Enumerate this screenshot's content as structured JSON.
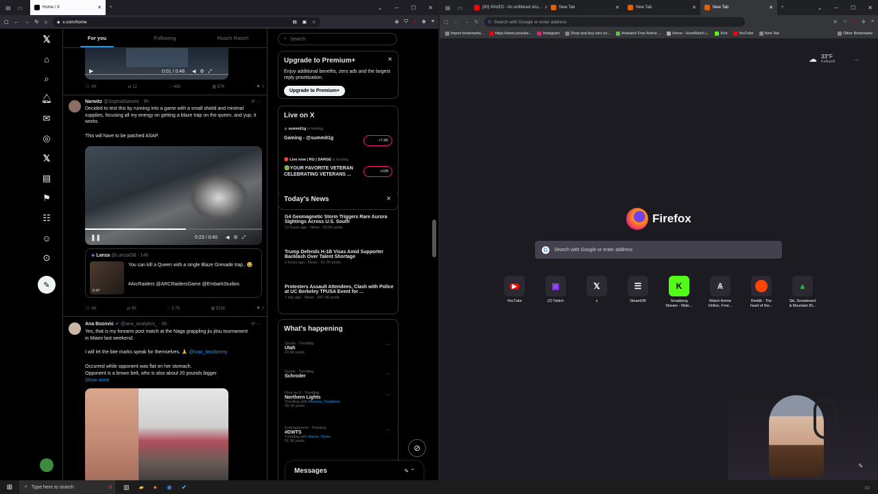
{
  "left_browser": {
    "tabs": [
      {
        "label": "Home / X",
        "active": true
      },
      {
        "label": "New Tab",
        "active": false
      }
    ],
    "url": "x.com/home"
  },
  "x": {
    "nav_tabs": [
      "For you",
      "Following",
      "Roach Ranch"
    ],
    "search_placeholder": "Search",
    "tweet0": {
      "video_time": "0:01 / 0:48",
      "replies": "49",
      "reposts": "12",
      "likes": "450",
      "views": "57K"
    },
    "tweet1": {
      "name": "Narwitz",
      "handle": "@SophiaNarwitz · 9h",
      "text": "Decided to test this by running into a game with a small shield and minimal supplies, focusing all my energy on getting a blaze trap on the queen, and yup, it works.",
      "text2": "This will have to be patched ASAP.",
      "video_time": "0:23 / 0:40",
      "quote_name": "Lanza",
      "quote_handle": "@LanzaGB · 14h",
      "quote_text": "You can kill a Queen with a single Blaze Grenade trap.. 😂",
      "quote_tags": "#ArcRaiders @ARCRaidersGame @EmbarkStudios",
      "quote_dur": "0:47",
      "replies": "48",
      "reposts": "65",
      "likes": "2.7K",
      "views": "521K"
    },
    "tweet2": {
      "name": "Ana Bozovic",
      "handle": "@ana_analytics_ · 8h",
      "text": "Yes, that is my forearm post match at the Naga grappling jiu jitsu tournament in Miami last weekend.",
      "text2": "I will let the bite marks speak for themselves. 🙏",
      "mention": "@ivan_bezdomny",
      "text3": "Occurred while opponent was flat on her stomach.",
      "text4": "Opponent is a brown belt, who is also about 20 pounds bigger",
      "show_more": "Show more"
    },
    "premium": {
      "title": "Upgrade to Premium+",
      "desc": "Enjoy additional benefits, zero ads and the largest reply prioritization.",
      "button": "Upgrade to Premium+"
    },
    "live": {
      "title": "Live on X",
      "items": [
        {
          "host": "summit1g",
          "hosting": "is hosting",
          "title": "Gaming - @summit1g",
          "count": "+7.9K"
        },
        {
          "host": "Live now | RG | SARGE",
          "hosting": "is hosting",
          "title": "🟢YOUR FAVORITE VETERAN CELEBRATING VETERANS ...",
          "count": "+108"
        }
      ]
    },
    "news": {
      "title": "Today's News",
      "items": [
        {
          "headline": "G4 Geomagnetic Storm Triggers Rare Aurora Sightings Across U.S. South",
          "meta": "12 hours ago · News · 55.5K posts"
        },
        {
          "headline": "Trump Defends H-1B Visas Amid Supporter Backlash Over Talent Shortage",
          "meta": "2 hours ago · News · 61.7K posts"
        },
        {
          "headline": "Protesters Assault Attendees, Clash with Police at UC Berkeley TPUSA Event for ...",
          "meta": "1 day ago · News · 487.4K posts"
        }
      ]
    },
    "happening": {
      "title": "What's happening",
      "items": [
        {
          "cat": "Sports · Trending",
          "topic": "Utah",
          "sub": "43.6K posts"
        },
        {
          "cat": "Sports · Trending",
          "topic": "Schroder",
          "sub": ""
        },
        {
          "cat": "Only on X · Trending",
          "topic": "Northern Lights",
          "sub": "Trending with",
          "links": "#Aurora, Creighton",
          "posts": "39.1K posts"
        },
        {
          "cat": "Entertainment · Trending",
          "topic": "#DWTS",
          "sub": "Trending with",
          "links": "Elaine, Dylan",
          "posts": "51.9K posts"
        }
      ]
    },
    "messages": "Messages"
  },
  "right_browser": {
    "tabs": [
      {
        "label": "(90) PAVED - An unfiltered sho...",
        "active": false
      },
      {
        "label": "New Tab",
        "active": false
      },
      {
        "label": "New Tab",
        "active": false
      },
      {
        "label": "New Tab",
        "active": true
      }
    ],
    "url_placeholder": "Search with Google or enter address",
    "bookmarks": [
      "Import bookmarks...",
      "https://www.youtube...",
      "Instagram",
      "Shop and buy cars on...",
      "Aniwatch Free Anime ...",
      "Home - HuraWatch |...",
      "Kick",
      "YouTube",
      "New Tab",
      "Other Bookmarks"
    ],
    "weather": {
      "temp": "33°F",
      "place": "Kalispell"
    },
    "brand": "Firefox",
    "search_placeholder": "Search with Google or enter address",
    "shortcuts": [
      {
        "label": "YouTube",
        "color": "#ff0000"
      },
      {
        "label": "(2) Twitch",
        "color": "#9146ff"
      },
      {
        "label": "x",
        "color": "#000000"
      },
      {
        "label": "SteamDB",
        "color": "#ffffff"
      },
      {
        "label": "Smakberg Stream - Watc...",
        "color": "#53fc18"
      },
      {
        "label": "Watch Anime Online, Free...",
        "color": "#222222"
      },
      {
        "label": "Reddit - The heart of the...",
        "color": "#ff4500"
      },
      {
        "label": "Ski, Snowboard & Mountain Bi...",
        "color": "#2db34a"
      }
    ]
  },
  "taskbar": {
    "search_placeholder": "Type here to search"
  }
}
